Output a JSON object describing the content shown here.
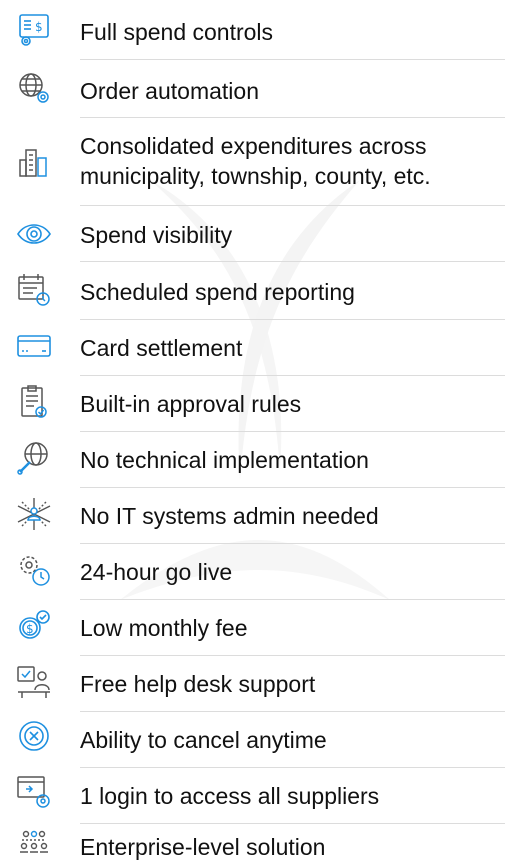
{
  "accent_color": "#1e90e0",
  "features": [
    {
      "icon": "spend-controls-icon",
      "label": "Full spend controls"
    },
    {
      "icon": "globe-gear-icon",
      "label": "Order automation"
    },
    {
      "icon": "buildings-icon",
      "label": "Consolidated expenditures across municipality, township, county, etc."
    },
    {
      "icon": "eye-icon",
      "label": "Spend visibility"
    },
    {
      "icon": "calendar-clock-icon",
      "label": "Scheduled spend reporting"
    },
    {
      "icon": "credit-card-icon",
      "label": "Card settlement"
    },
    {
      "icon": "clipboard-check-icon",
      "label": "Built-in approval rules"
    },
    {
      "icon": "globe-wrench-icon",
      "label": "No technical implementation"
    },
    {
      "icon": "network-person-icon",
      "label": "No IT systems admin needed"
    },
    {
      "icon": "gear-clock-icon",
      "label": "24-hour go live"
    },
    {
      "icon": "coin-check-icon",
      "label": "Low monthly fee"
    },
    {
      "icon": "helpdesk-icon",
      "label": "Free help desk support"
    },
    {
      "icon": "cancel-circle-icon",
      "label": "Ability to cancel anytime"
    },
    {
      "icon": "login-window-icon",
      "label": "1 login to access all suppliers"
    },
    {
      "icon": "people-network-icon",
      "label": "Enterprise-level solution"
    }
  ]
}
